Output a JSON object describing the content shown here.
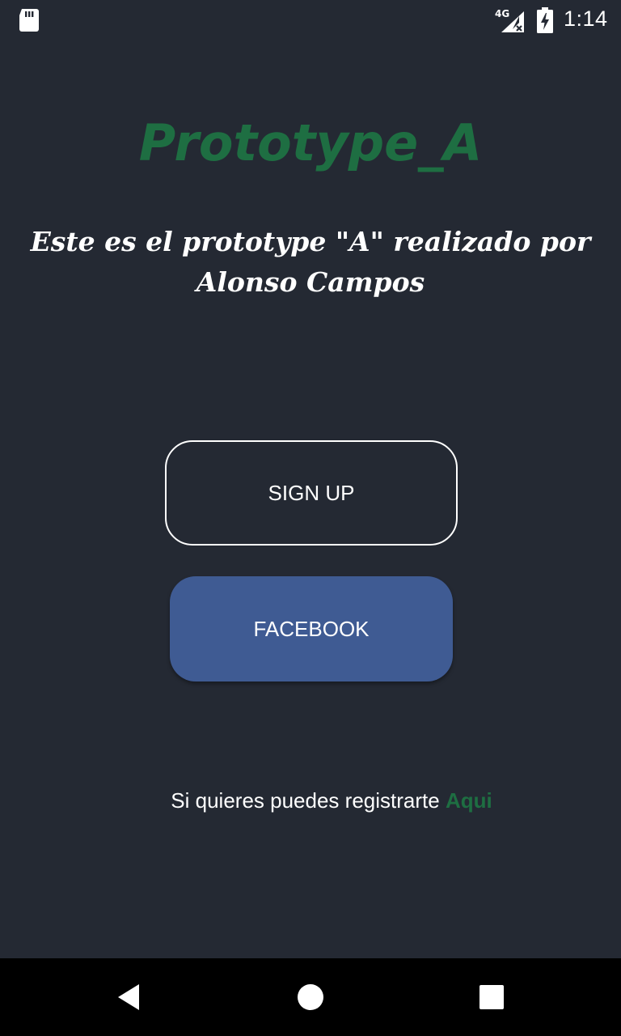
{
  "status_bar": {
    "network_label": "4G",
    "time": "1:14",
    "icons": [
      "sd-card-icon",
      "signal-4g-no-data-icon",
      "battery-charging-icon"
    ]
  },
  "main": {
    "title": "Prototype_A",
    "subtitle": "Este es el prototype \"A\" realizado por Alonso Campos",
    "signup_label": "SIGN UP",
    "facebook_label": "FACEBOOK",
    "register_text": "Si quieres puedes registrarte",
    "register_link": "Aqui"
  },
  "nav_bar": {
    "icons": [
      "back-icon",
      "home-icon",
      "recents-icon"
    ]
  },
  "colors": {
    "background": "#242933",
    "accent_green": "#1e6e42",
    "facebook_blue": "#3f5b93",
    "text": "#ffffff"
  }
}
